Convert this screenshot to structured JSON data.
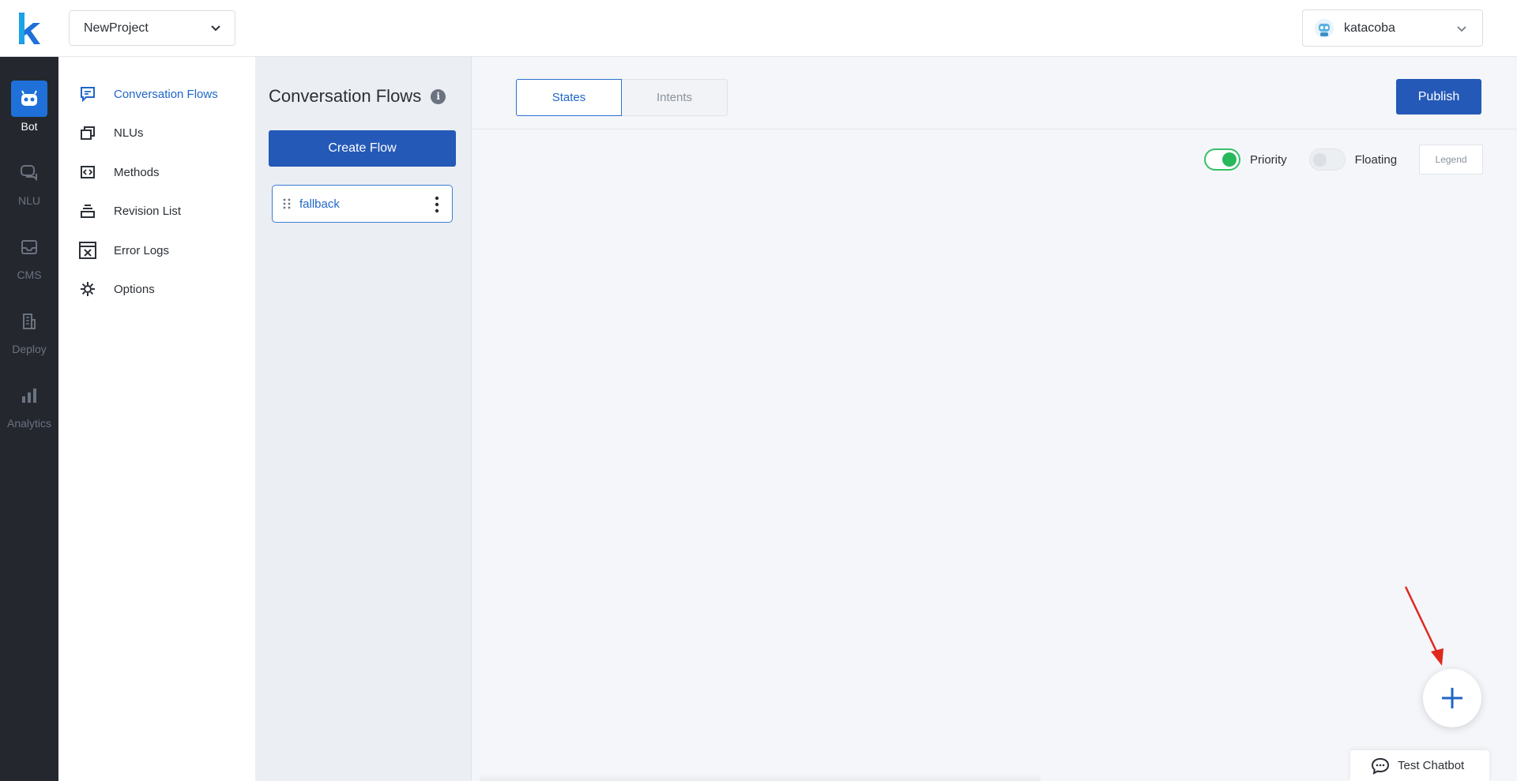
{
  "header": {
    "project": "NewProject",
    "user": "katacoba"
  },
  "rail": {
    "items": [
      {
        "label": "Bot",
        "icon": "robot-icon",
        "active": true
      },
      {
        "label": "NLU",
        "icon": "chat-bubbles-icon"
      },
      {
        "label": "CMS",
        "icon": "inbox-icon"
      },
      {
        "label": "Deploy",
        "icon": "building-icon"
      },
      {
        "label": "Analytics",
        "icon": "bar-chart-icon"
      }
    ]
  },
  "subnav": {
    "items": [
      {
        "label": "Conversation Flows",
        "icon": "message-icon",
        "active": true
      },
      {
        "label": "NLUs",
        "icon": "layers-icon"
      },
      {
        "label": "Methods",
        "icon": "code-icon"
      },
      {
        "label": "Revision List",
        "icon": "stack-icon"
      },
      {
        "label": "Error Logs",
        "icon": "error-window-icon"
      },
      {
        "label": "Options",
        "icon": "gear-icon"
      }
    ]
  },
  "flows": {
    "title": "Conversation Flows",
    "info": "i",
    "create_label": "Create Flow",
    "items": [
      {
        "name": "fallback"
      }
    ]
  },
  "main": {
    "tabs": [
      {
        "label": "States",
        "active": true
      },
      {
        "label": "Intents"
      }
    ],
    "publish_label": "Publish",
    "toggles": [
      {
        "label": "Priority",
        "on": true
      },
      {
        "label": "Floating",
        "on": false
      }
    ],
    "legend_label": "Legend",
    "test_chatbot_label": "Test Chatbot"
  },
  "colors": {
    "accent": "#2459b7",
    "link": "#1f66c7",
    "rail_bg": "#24282e",
    "toggle_on": "#28b85c",
    "annotation_arrow": "#e0281e"
  }
}
